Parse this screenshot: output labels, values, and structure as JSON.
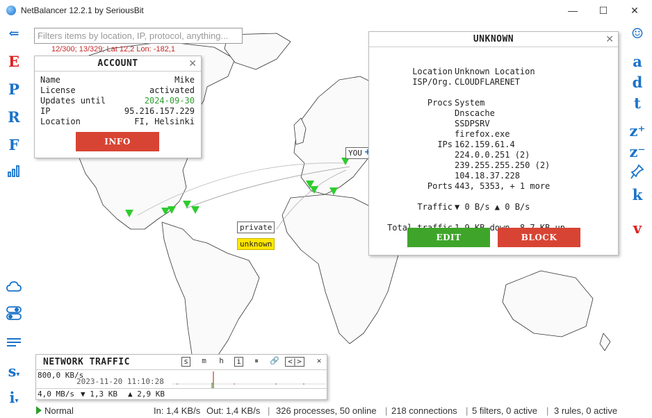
{
  "app": {
    "title": "NetBalancer 12.2.1 by SeriousBit"
  },
  "window_controls": {
    "minimize": "—",
    "maximize": "☐",
    "close": "✕"
  },
  "left_toolbar": {
    "back_icon": "arrow-left-icon",
    "letters": [
      "E",
      "P",
      "R",
      "F"
    ],
    "letter_colors": [
      "#e02020",
      "#1a73c9",
      "#1a73c9",
      "#1a73c9"
    ],
    "chart_icon": "bar-chart-icon",
    "cloud_icon": "cloud-icon",
    "toggle_icon": "toggle-icon",
    "list_icon": "list-icon",
    "s_label": "s",
    "i_label": "i"
  },
  "right_toolbar": {
    "smiley_icon": "smiley-icon",
    "items": [
      "a",
      "d",
      "t",
      "z⁺",
      "z⁻"
    ],
    "pin_icon": "pin-icon",
    "k_label": "k",
    "v_label": "v"
  },
  "search": {
    "placeholder": "Filters items by location, IP, protocol, anything..."
  },
  "coords": "12/300; 13/329; Lat 12,2 Lon: -182,1",
  "account": {
    "title": "ACCOUNT",
    "rows": [
      {
        "k": "Name",
        "v": "Mike"
      },
      {
        "k": "License",
        "v": "activated"
      },
      {
        "k": "Updates until",
        "v": "2024-09-30"
      },
      {
        "k": "IP",
        "v": "95.216.157.229"
      },
      {
        "k": "Location",
        "v": "FI, Helsinki"
      }
    ],
    "info_button": "INFO"
  },
  "unknown": {
    "title": "UNKNOWN",
    "location_k": "Location",
    "location_v": "Unknown Location",
    "isp_k": "ISP/Org.",
    "isp_v": "CLOUDFLARENET",
    "procs_k": "Procs",
    "procs": [
      "System",
      "Dnscache",
      "SSDPSRV",
      "firefox.exe"
    ],
    "ips_k": "IPs",
    "ips": [
      "162.159.61.4",
      "224.0.0.251 (2)",
      "239.255.255.250 (2)",
      "104.18.37.228"
    ],
    "ports_k": "Ports",
    "ports_v": "443, 5353, + 1 more",
    "traffic_k": "Traffic",
    "traffic_v": "▼ 0 B/s  ▲ 0 B/s",
    "total_k": "Total traffic",
    "total_v": "1,9 KB down, 8,7 KB up",
    "edit_button": "EDIT",
    "block_button": "BLOCK"
  },
  "map_tags": {
    "private": "private",
    "unknown": "unknown",
    "you": "YOU"
  },
  "network_traffic": {
    "title": "NETWORK TRAFFIC",
    "buttons": [
      "s",
      "m",
      "h",
      "i",
      "⏸",
      "🔗",
      "<|>",
      "✕"
    ],
    "scale_top": "800,0 KB/s",
    "timestamp": "2023-11-20 11:10:28",
    "scale_bottom": "4,0 MB/s",
    "down": "▼ 1,3 KB",
    "up": "▲ 2,9 KB"
  },
  "status": {
    "mode": "Normal",
    "in": "In: 1,4 KB/s",
    "out": "Out: 1,4 KB/s",
    "processes": "326 processes, 50 online",
    "connections": "218 connections",
    "filters": "5 filters, 0 active",
    "rules": "3 rules, 0 active"
  },
  "colors": {
    "accent": "#1a73c9",
    "red": "#d84434",
    "green": "#3fa52a",
    "pin": "#2ecc2e"
  }
}
